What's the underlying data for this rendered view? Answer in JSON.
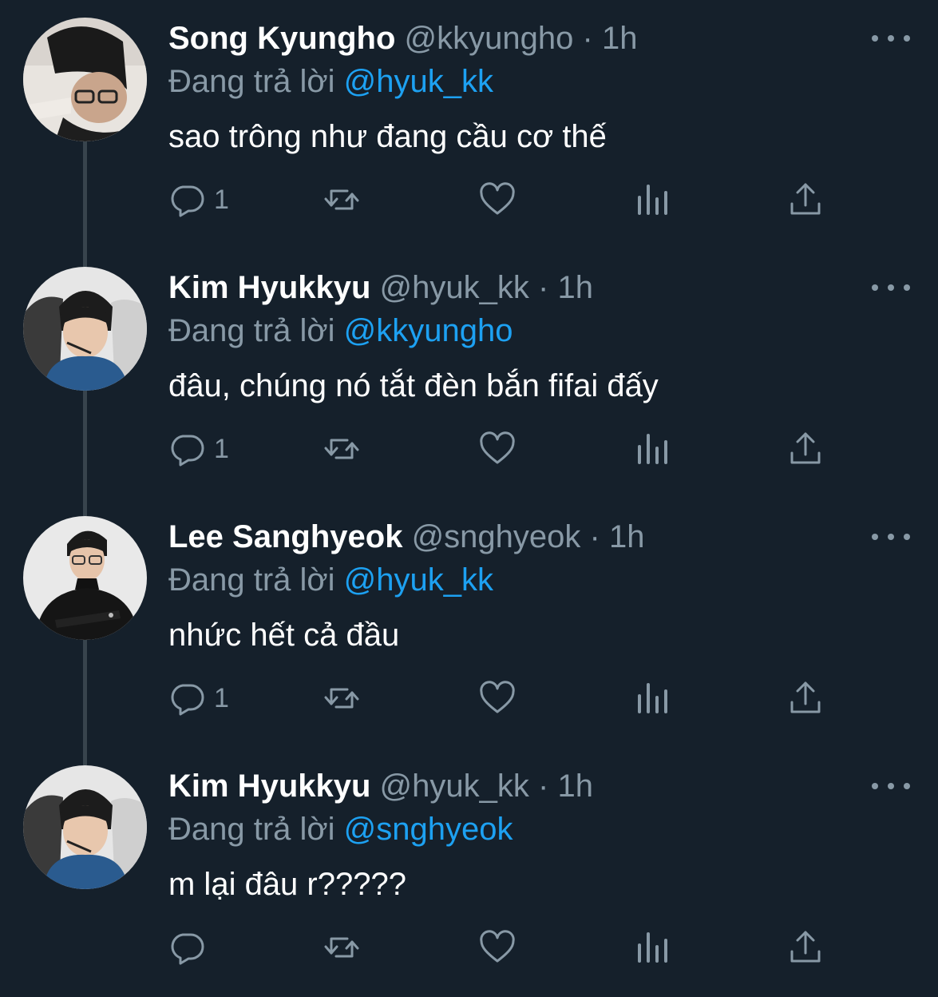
{
  "replying_label": "Đang trả lời",
  "tweets": [
    {
      "name": "Song Kyungho",
      "handle": "@kkyungho",
      "dot": "·",
      "time": "1h",
      "reply_to": "@hyuk_kk",
      "text": "sao trông như đang cầu cơ thế",
      "reply_count": "1",
      "avatar": "avatar-song-kyungho"
    },
    {
      "name": "Kim Hyukkyu",
      "handle": "@hyuk_kk",
      "dot": "·",
      "time": "1h",
      "reply_to": "@kkyungho",
      "text": "đâu, chúng nó tắt đèn bắn fifai đấy",
      "reply_count": "1",
      "avatar": "avatar-kim-hyukkyu"
    },
    {
      "name": "Lee Sanghyeok",
      "handle": "@snghyeok",
      "dot": "·",
      "time": "1h",
      "reply_to": "@hyuk_kk",
      "text": "nhức hết cả đầu",
      "reply_count": "1",
      "avatar": "avatar-lee-sanghyeok"
    },
    {
      "name": "Kim Hyukkyu",
      "handle": "@hyuk_kk",
      "dot": "·",
      "time": "1h",
      "reply_to": "@snghyeok",
      "text": "m lại đâu r?????",
      "reply_count": "",
      "avatar": "avatar-kim-hyukkyu"
    }
  ],
  "colors": {
    "background": "#15202b",
    "secondary_text": "#8899a6",
    "mention": "#1da1f2",
    "thread_line": "#38444d"
  },
  "icons": [
    "reply-icon",
    "retweet-icon",
    "like-icon",
    "analytics-icon",
    "share-icon",
    "more-options-icon"
  ]
}
